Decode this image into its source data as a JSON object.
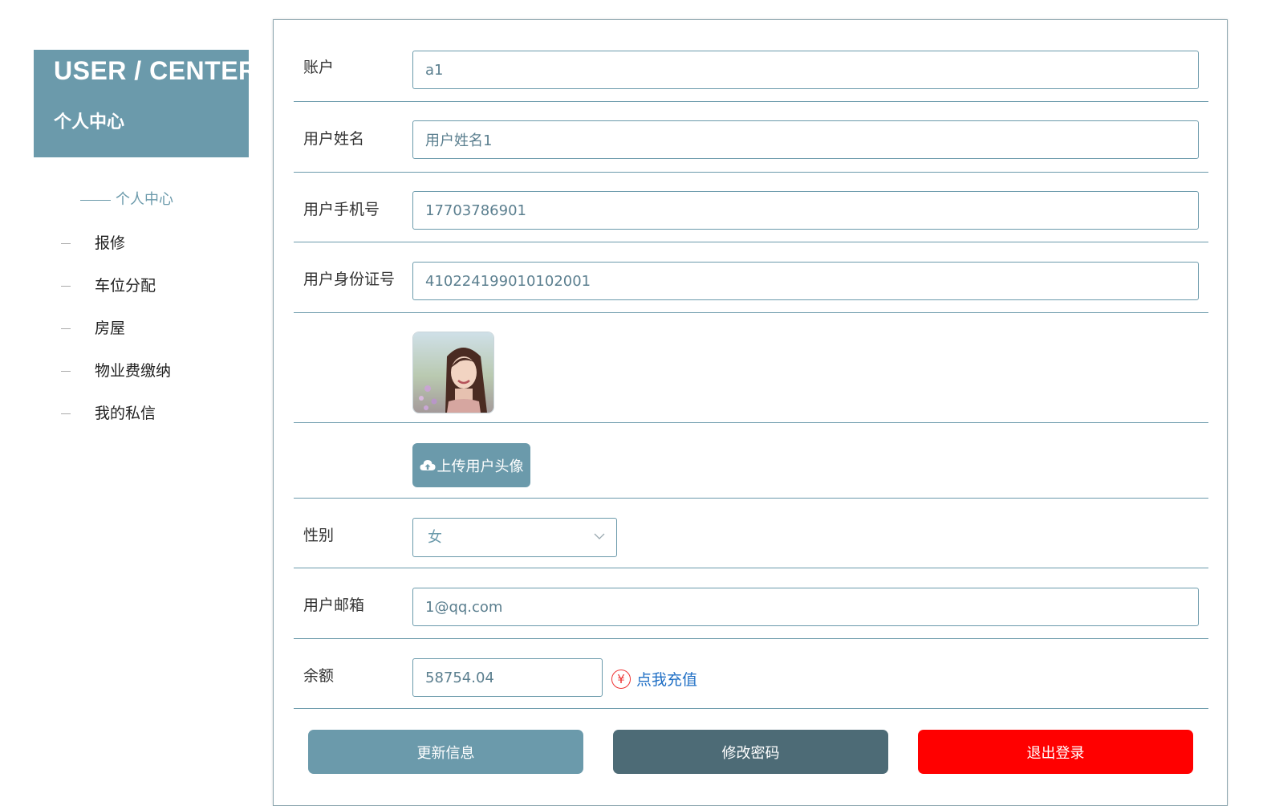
{
  "sidebar": {
    "title_en": "USER / CENTER",
    "title_cn": "个人中心",
    "active_item": "个人中心",
    "items": [
      {
        "label": "报修"
      },
      {
        "label": "车位分配"
      },
      {
        "label": "房屋"
      },
      {
        "label": "物业费缴纳"
      },
      {
        "label": "我的私信"
      }
    ]
  },
  "form": {
    "account": {
      "label": "账户",
      "value": "a1"
    },
    "name": {
      "label": "用户姓名",
      "value": "用户姓名1"
    },
    "phone": {
      "label": "用户手机号",
      "value": "17703786901"
    },
    "id_card": {
      "label": "用户身份证号",
      "value": "410224199010102001"
    },
    "upload_label": "上传用户头像",
    "gender": {
      "label": "性别",
      "value": "女"
    },
    "email": {
      "label": "用户邮箱",
      "value": "1@qq.com"
    },
    "balance": {
      "label": "余额",
      "value": "58754.04",
      "recharge_label": "点我充值",
      "currency_symbol": "¥"
    }
  },
  "buttons": {
    "update": {
      "label": "更新信息",
      "color": "#6b9aab"
    },
    "password": {
      "label": "修改密码",
      "color": "#4d6b76"
    },
    "logout": {
      "label": "退出登录",
      "color": "#ff0000"
    }
  },
  "icons": {
    "upload": "cloud-upload-icon",
    "select": "chevron-down-icon",
    "recharge": "yuan-icon"
  }
}
